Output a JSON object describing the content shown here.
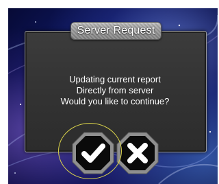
{
  "dialog": {
    "title": "Server Request",
    "message_lines": [
      "Updating current report",
      "Directly from server",
      "Would you like to continue?"
    ]
  },
  "buttons": {
    "confirm_icon": "checkmark-icon",
    "cancel_icon": "x-icon"
  },
  "colors": {
    "panel": "#333333",
    "highlight_ring": "#d9d24a",
    "text": "#ffffff",
    "background": "#0d1557"
  }
}
